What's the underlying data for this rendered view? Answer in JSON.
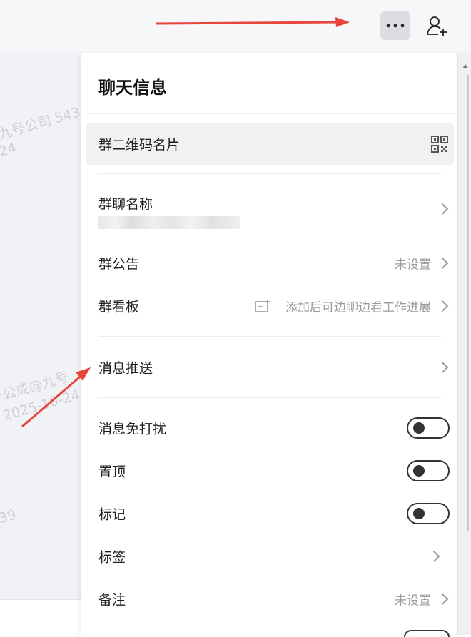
{
  "panel": {
    "title": "聊天信息",
    "qr_card_label": "群二维码名片",
    "group_name_label": "群聊名称",
    "announcement": {
      "label": "群公告",
      "value": "未设置"
    },
    "board": {
      "label": "群看板",
      "value": "添加后可边聊边看工作进展"
    },
    "push": {
      "label": "消息推送"
    },
    "dnd": {
      "label": "消息免打扰",
      "on": false
    },
    "pin": {
      "label": "置顶",
      "on": false
    },
    "mark": {
      "label": "标记",
      "on": false
    },
    "tags": {
      "label": "标签"
    },
    "remark": {
      "label": "备注",
      "value": "未设置"
    }
  },
  "watermarks": [
    "九号公司 543",
    "24",
    "于公成@九号",
    "2025-10-24",
    "39"
  ],
  "colors": {
    "annotation_arrow": "#e8453c",
    "toggle_off": "#333333"
  }
}
